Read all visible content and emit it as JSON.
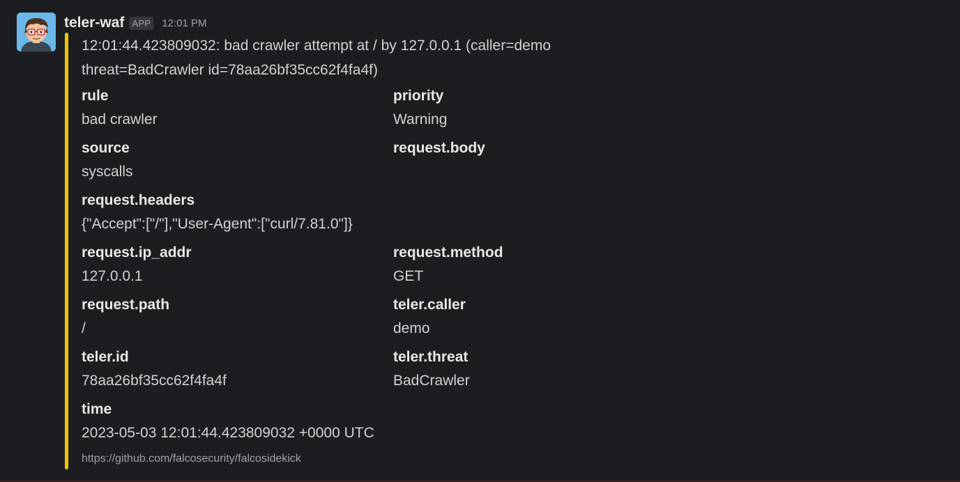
{
  "message": {
    "sender": "teler-waf",
    "badge": "APP",
    "timestamp": "12:01 PM",
    "avatar_icon": "cartoon-face-with-glasses-icon"
  },
  "attachment": {
    "color": "#f2c300",
    "pretext_line1": "12:01:44.423809032: bad crawler attempt at / by 127.0.0.1 (caller=demo",
    "pretext_line2": "threat=BadCrawler id=78aa26bf35cc62f4fa4f)",
    "fields": [
      {
        "title": "rule",
        "value": "bad crawler"
      },
      {
        "title": "priority",
        "value": "Warning"
      },
      {
        "title": "source",
        "value": "syscalls"
      },
      {
        "title": "request.body",
        "value": ""
      },
      {
        "title": "request.headers",
        "value": "{\"Accept\":[\"/\"],\"User-Agent\":[\"curl/7.81.0\"]}"
      },
      {
        "title": "request.ip_addr",
        "value": "127.0.0.1"
      },
      {
        "title": "request.method",
        "value": "GET"
      },
      {
        "title": "request.path",
        "value": "/"
      },
      {
        "title": "teler.caller",
        "value": "demo"
      },
      {
        "title": "teler.id",
        "value": "78aa26bf35cc62f4fa4f"
      },
      {
        "title": "teler.threat",
        "value": "BadCrawler"
      },
      {
        "title": "time",
        "value": "2023-05-03 12:01:44.423809032 +0000 UTC"
      }
    ],
    "footer": "https://github.com/falcosecurity/falcosidekick"
  }
}
